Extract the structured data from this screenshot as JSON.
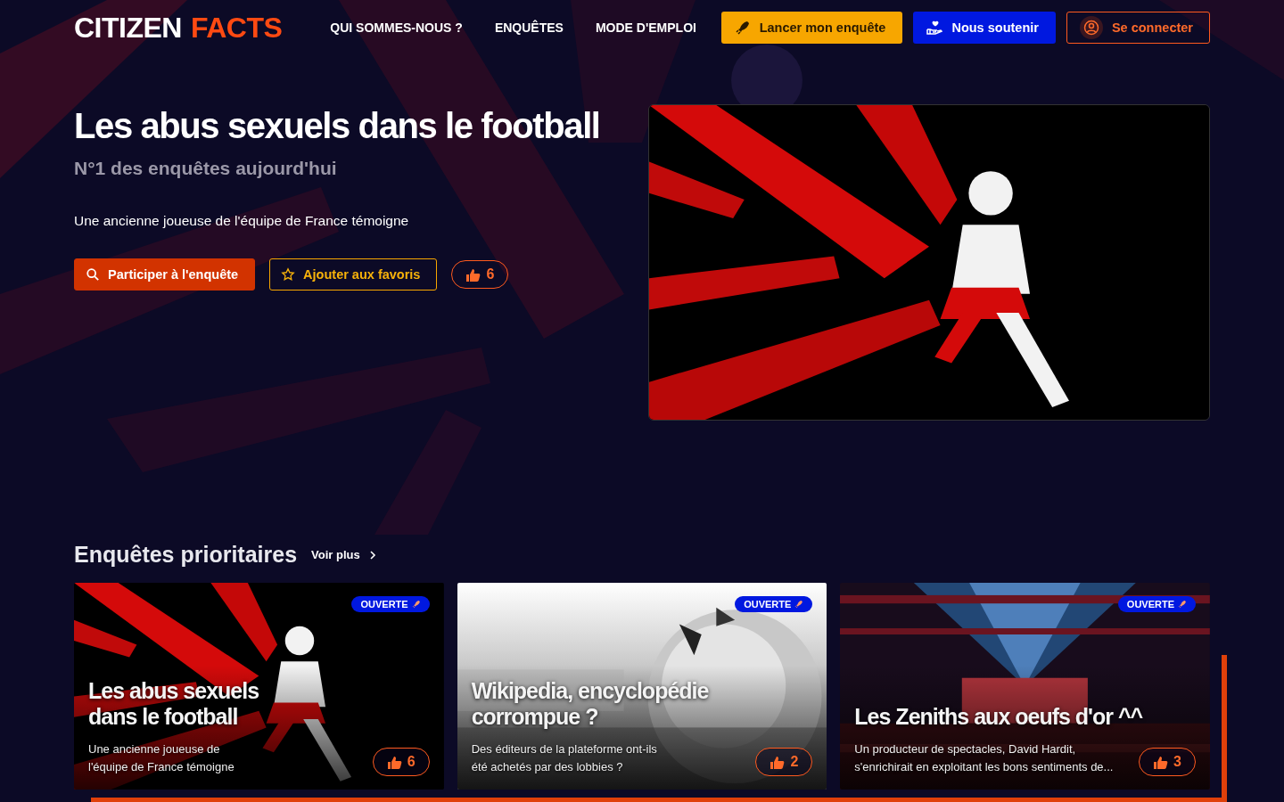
{
  "header": {
    "logo": [
      {
        "text": "CITIZEN",
        "accent": false
      },
      {
        "text": "FACTS",
        "accent": true
      }
    ],
    "nav": [
      "QUI SOMMES-NOUS ?",
      "ENQUÊTES",
      "MODE D'EMPLOI"
    ],
    "actions": [
      {
        "label": "Lancer mon enquête",
        "kind": "launch"
      },
      {
        "label": "Nous soutenir",
        "kind": "support"
      },
      {
        "label": "Se connecter",
        "kind": "login"
      }
    ]
  },
  "hero": {
    "title": "Les abus sexuels dans le football",
    "subtitle": "N°1 des enquêtes aujourd'hui",
    "description": "Une ancienne joueuse de l'équipe de France témoigne",
    "buttons": [
      {
        "label": "Participer à l'enquête",
        "kind": "participate"
      },
      {
        "label": "Ajouter aux favoris",
        "kind": "favorite"
      }
    ],
    "likes": "6"
  },
  "section": {
    "title": "Enquêtes prioritaires",
    "more": "Voir plus",
    "cards": [
      {
        "kind": "runner",
        "badge": "OUVERTE",
        "title": "Les abus sexuels dans le football",
        "description": "Une ancienne joueuse de l'équipe de France témoigne",
        "likes": "6"
      },
      {
        "kind": "globe",
        "badge": "OUVERTE",
        "title": "Wikipedia, encyclopédie corrompue ?",
        "description": "Des éditeurs de la plateforme ont-ils été achetés par des lobbies ?",
        "likes": "2"
      },
      {
        "kind": "stage",
        "badge": "OUVERTE",
        "title": "Les Zeniths aux oeufs d'or ^^",
        "description": "Un producteur de spectacles, David Hardit, s'enrichirait en exploitant les bons sentiments de...",
        "likes": "3"
      }
    ]
  }
}
